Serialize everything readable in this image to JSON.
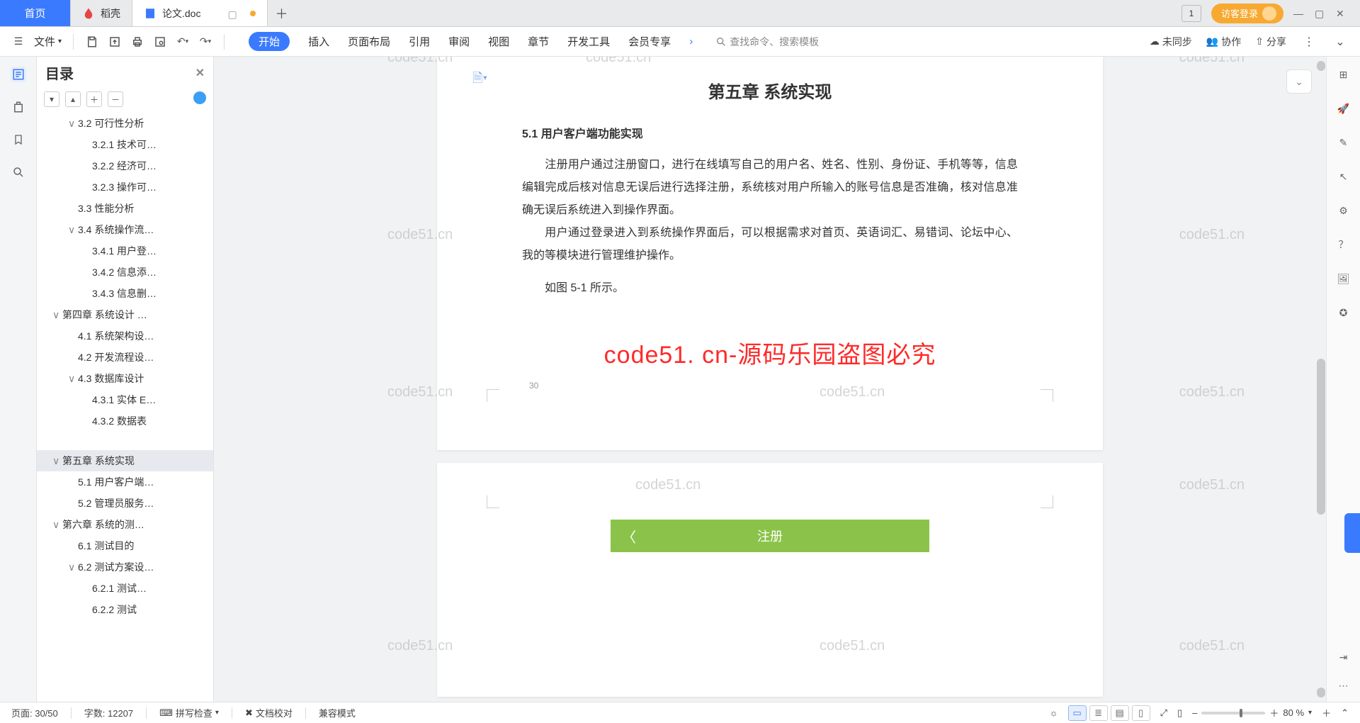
{
  "tabs": {
    "home": "首页",
    "docke": "稻壳",
    "doc": "论文.doc"
  },
  "title_right": {
    "badge": "1",
    "login": "访客登录"
  },
  "ribbon": {
    "file": "文件",
    "tabs": [
      "开始",
      "插入",
      "页面布局",
      "引用",
      "审阅",
      "视图",
      "章节",
      "开发工具",
      "会员专享"
    ],
    "search_ph": "查找命令、搜索模板",
    "unsync": "未同步",
    "collab": "协作",
    "share": "分享"
  },
  "outline": {
    "title": "目录",
    "items": [
      {
        "lvl": 1,
        "chev": "∨",
        "label": "3.2 可行性分析"
      },
      {
        "lvl": 2,
        "label": "3.2.1 技术可…"
      },
      {
        "lvl": 2,
        "label": "3.2.2 经济可…"
      },
      {
        "lvl": 2,
        "label": "3.2.3 操作可…"
      },
      {
        "lvl": 1,
        "label": "3.3 性能分析"
      },
      {
        "lvl": 1,
        "chev": "∨",
        "label": "3.4 系统操作流…"
      },
      {
        "lvl": 2,
        "label": "3.4.1 用户登…"
      },
      {
        "lvl": 2,
        "label": "3.4.2 信息添…"
      },
      {
        "lvl": 2,
        "label": "3.4.3 信息删…"
      },
      {
        "lvl": 0,
        "chev": "∨",
        "label": "第四章  系统设计 …"
      },
      {
        "lvl": 1,
        "label": "4.1 系统架构设…"
      },
      {
        "lvl": 1,
        "label": "4.2 开发流程设…"
      },
      {
        "lvl": 1,
        "chev": "∨",
        "label": "4.3 数据库设计"
      },
      {
        "lvl": 2,
        "label": "4.3.1 实体 E…"
      },
      {
        "lvl": 2,
        "label": "4.3.2 数据表"
      },
      {
        "lvl": 0,
        "chev": "∨",
        "label": "第五章  系统实现",
        "sel": true
      },
      {
        "lvl": 1,
        "label": "5.1 用户客户端…"
      },
      {
        "lvl": 1,
        "label": "5.2 管理员服务…"
      },
      {
        "lvl": 0,
        "chev": "∨",
        "label": "第六章   系统的测…"
      },
      {
        "lvl": 1,
        "label": "6.1 测试目的"
      },
      {
        "lvl": 1,
        "chev": "∨",
        "label": "6.2 测试方案设…"
      },
      {
        "lvl": 2,
        "label": "6.2.1 测试…"
      },
      {
        "lvl": 2,
        "label": "6.2.2 测试"
      }
    ]
  },
  "doc": {
    "chapter_title": "第五章  系统实现",
    "section": "5.1 用户客户端功能实现",
    "para1": "注册用户通过注册窗口，进行在线填写自己的用户名、姓名、性别、身份证、手机等等，信息编辑完成后核对信息无误后进行选择注册，系统核对用户所输入的账号信息是否准确，核对信息准确无误后系统进入到操作界面。",
    "para2": "用户通过登录进入到系统操作界面后，可以根据需求对首页、英语词汇、易错词、论坛中心、我的等模块进行管理维护操作。",
    "para3": "如图 5-1 所示。",
    "red_wm": "code51. cn-源码乐园盗图必究",
    "page_num": "30",
    "grey_wm": "code51.cn",
    "register": "注册"
  },
  "status": {
    "page": "页面: 30/50",
    "words": "字数: 12207",
    "spell": "拼写检查",
    "proof": "文档校对",
    "compat": "兼容模式",
    "zoom": "80 %"
  }
}
